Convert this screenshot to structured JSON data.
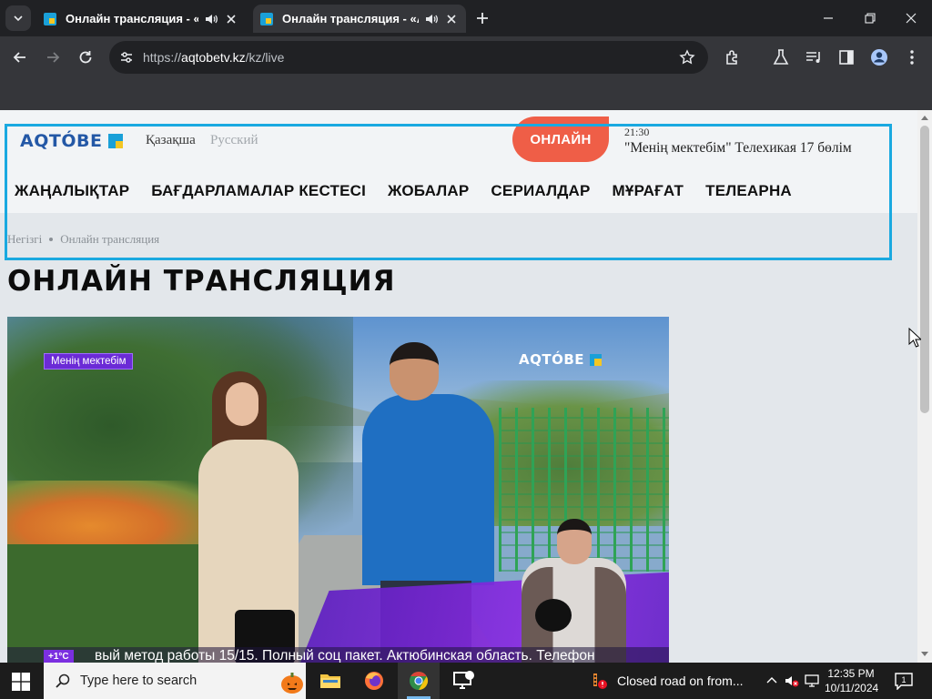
{
  "browser": {
    "tabs": [
      {
        "title": "Онлайн трансляция - «АТ",
        "active": false
      },
      {
        "title": "Онлайн трансляция - «АС",
        "active": true
      }
    ],
    "url_scheme": "https://",
    "url_host": "aqtobetv.kz",
    "url_path": "/kz/live"
  },
  "site": {
    "logo_text": "AQTÓBE",
    "lang_kz": "Қазақша",
    "lang_ru": "Русский",
    "online_label": "ОНЛАЙН",
    "now_time": "21:30",
    "now_title": "\"Менің мектебім\" Телехикая 17 бөлім",
    "nav": [
      "ЖАҢАЛЫҚТАР",
      "БАҒДАРЛАМАЛАР КЕСТЕСІ",
      "ЖОБАЛАР",
      "СЕРИАЛДАР",
      "МҰРАҒАТ",
      "ТЕЛЕАРНА"
    ],
    "breadcrumb_home": "Негізгі",
    "breadcrumb_current": "Онлайн трансляция",
    "page_title": "ОНЛАЙН ТРАНСЛЯЦИЯ"
  },
  "video": {
    "show_badge": "Менің мектебім",
    "channel_logo": "AQTÓBE",
    "temperature": "+1°C",
    "ticker": "вый метод работы 15/15. Полный соц пакет. Актюбинская область. Телефон"
  },
  "taskbar": {
    "search_placeholder": "Type here to search",
    "notification": "Closed road on from...",
    "time": "12:35 PM",
    "date": "10/11/2024",
    "notification_count": "1"
  },
  "colors": {
    "accent_online": "#ef5e47",
    "logo_blue": "#2458a6",
    "highlight_box": "#1aa9e0",
    "video_purple": "#6b2bd6"
  }
}
